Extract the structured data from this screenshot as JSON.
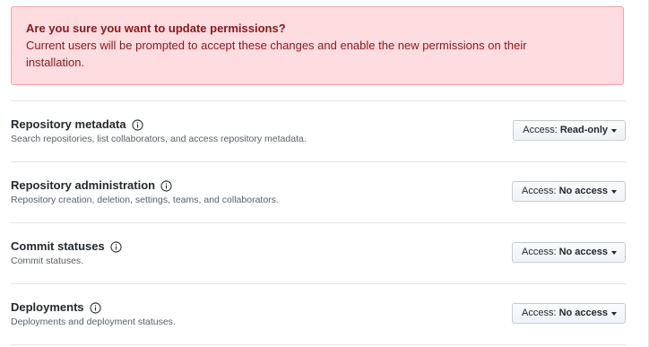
{
  "alert": {
    "title": "Are you sure you want to update permissions?",
    "body": "Current users will be prompted to accept these changes and enable the new permissions on their installation."
  },
  "permissions": [
    {
      "name": "Repository metadata",
      "description": "Search repositories, list collaborators, and access repository metadata.",
      "access_prefix": "Access:",
      "access_value": "Read-only"
    },
    {
      "name": "Repository administration",
      "description": "Repository creation, deletion, settings, teams, and collaborators.",
      "access_prefix": "Access:",
      "access_value": "No access"
    },
    {
      "name": "Commit statuses",
      "description": "Commit statuses.",
      "access_prefix": "Access:",
      "access_value": "No access"
    },
    {
      "name": "Deployments",
      "description": "Deployments and deployment statuses.",
      "access_prefix": "Access:",
      "access_value": "No access"
    }
  ],
  "icons": {
    "info": "info-icon",
    "caret": "chevron-down-icon"
  },
  "colors": {
    "alert_background": "#ffdce0",
    "alert_text": "#86181d",
    "divider": "#e1e4e8",
    "description_text": "#586069"
  }
}
